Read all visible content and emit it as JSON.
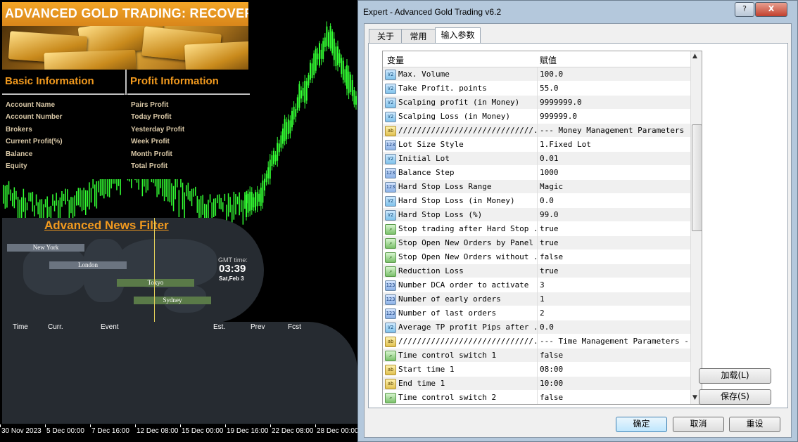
{
  "chart": {
    "banner_title": "ADVANCED GOLD TRADING: RECOVERY",
    "dates": [
      "30 Nov 2023",
      "5 Dec 00:00",
      "7 Dec 16:00",
      "12 Dec 08:00",
      "15 Dec 00:00",
      "19 Dec 16:00",
      "22 Dec 08:00",
      "28 Dec 00:00"
    ],
    "info": {
      "basic_title": "Basic Information",
      "profit_title": "Profit Information",
      "basic_rows": [
        "Account Name",
        "Account Number",
        "Brokers",
        "Current Profit(%)",
        "Balance",
        "Equity"
      ],
      "profit_rows": [
        "Pairs Profit",
        "Today Profit",
        "Yesterday Profit",
        "Week Profit",
        "Month Profit",
        "Total Profit"
      ]
    },
    "news": {
      "title": "Advanced News Filter",
      "sessions": [
        "New York",
        "London",
        "Tokyo",
        "Sydney"
      ],
      "gmt_label": "GMT time:",
      "gmt_time": "03:39",
      "gmt_date": "Sat,Feb 3",
      "headers": [
        "Time",
        "Curr.",
        "Event",
        "Est.",
        "Prev",
        "Fcst"
      ]
    },
    "colors": {
      "candle": "#33ff33",
      "accent": "#f29a1e"
    }
  },
  "dialog": {
    "title": "Expert - Advanced Gold Trading v6.2",
    "title_buttons": [
      "?",
      "X"
    ],
    "tabs": [
      "关于",
      "常用",
      "输入参数"
    ],
    "columns": [
      "变量",
      "赋值"
    ],
    "params": [
      {
        "icon": "v2",
        "name": "Max. Volume",
        "value": "100.0"
      },
      {
        "icon": "v2",
        "name": "Take Profit. points",
        "value": "55.0"
      },
      {
        "icon": "v2",
        "name": "Scalping profit (in Money)",
        "value": "9999999.0"
      },
      {
        "icon": "v2",
        "name": "Scalping Loss (in Money)",
        "value": "999999.0"
      },
      {
        "icon": "ab",
        "name": "/////////////////////////////...",
        "value": "--- Money Management Parameters ---"
      },
      {
        "icon": "n123",
        "name": "Lot Size Style",
        "value": "1.Fixed Lot"
      },
      {
        "icon": "v2",
        "name": "Initial Lot",
        "value": "0.01"
      },
      {
        "icon": "n123",
        "name": "Balance Step",
        "value": "1000"
      },
      {
        "icon": "n123",
        "name": "Hard Stop Loss Range",
        "value": "Magic"
      },
      {
        "icon": "v2",
        "name": "Hard Stop Loss (in Money)",
        "value": "0.0"
      },
      {
        "icon": "v2",
        "name": "Hard Stop Loss (%)",
        "value": "99.0"
      },
      {
        "icon": "bool",
        "name": "Stop trading after Hard Stop ...",
        "value": "true"
      },
      {
        "icon": "bool",
        "name": "Stop Open New Orders by Panel",
        "value": "true"
      },
      {
        "icon": "bool",
        "name": "Stop Open New Orders without ...",
        "value": "false"
      },
      {
        "icon": "bool",
        "name": "Reduction Loss",
        "value": "true"
      },
      {
        "icon": "n123",
        "name": "Number DCA order to activate",
        "value": "3"
      },
      {
        "icon": "n123",
        "name": "Number of early orders",
        "value": "1"
      },
      {
        "icon": "n123",
        "name": "Number of last orders",
        "value": "2"
      },
      {
        "icon": "v2",
        "name": "Average TP profit Pips after ...",
        "value": "0.0"
      },
      {
        "icon": "ab",
        "name": "/////////////////////////////...",
        "value": "--- Time Management Parameters ---"
      },
      {
        "icon": "bool",
        "name": "Time control switch 1",
        "value": "false"
      },
      {
        "icon": "ab",
        "name": "Start time 1",
        "value": "08:00"
      },
      {
        "icon": "ab",
        "name": "End time 1",
        "value": "10:00"
      },
      {
        "icon": "bool",
        "name": "Time control switch 2",
        "value": "false"
      }
    ],
    "icon_glyphs": {
      "v2": "V2",
      "n123": "123",
      "ab": "ab",
      "bool": "↗"
    },
    "side_buttons": [
      "加载(L)",
      "保存(S)"
    ],
    "bottom_buttons": [
      "确定",
      "取消",
      "重设"
    ]
  }
}
